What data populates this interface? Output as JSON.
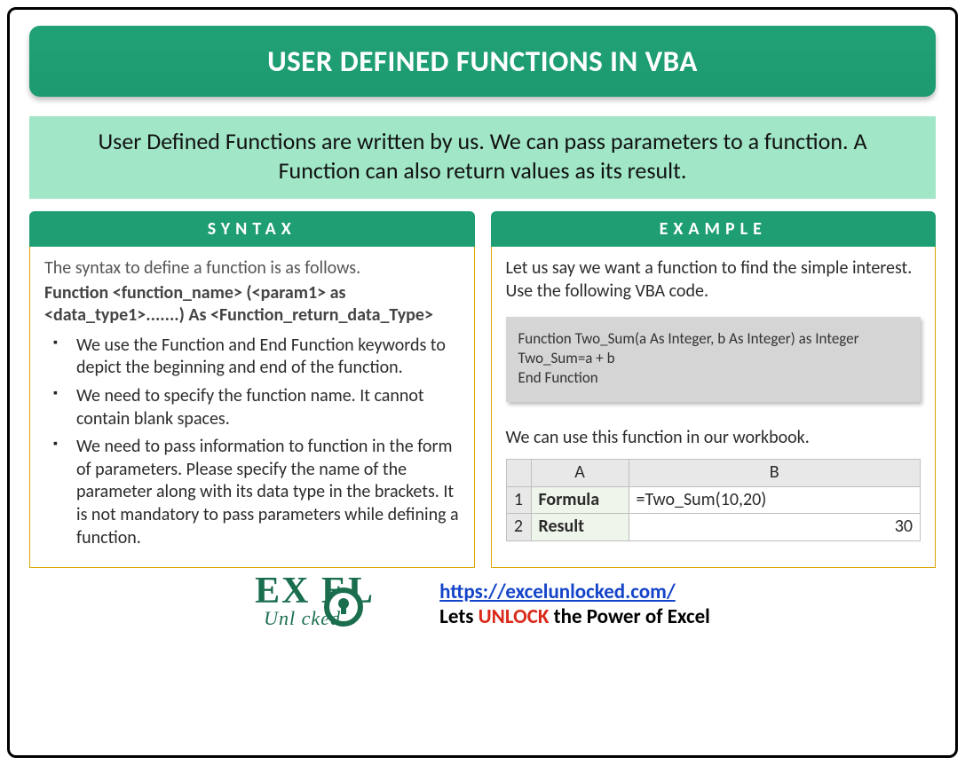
{
  "title": "USER DEFINED FUNCTIONS IN VBA",
  "intro": "User Defined Functions are written by us. We can pass parameters to a function. A Function can also return values as its result.",
  "syntax": {
    "header": "SYNTAX",
    "lead": "The syntax to define a function is as follows.",
    "signature": "Function <function_name> (<param1> as <data_type1>.......) As <Function_return_data_Type>",
    "bullets": [
      "We use the Function and End Function keywords to depict the beginning and end of the function.",
      "We need to specify the function name. It cannot contain blank spaces.",
      "We need to pass information to function in the form of parameters. Please specify the name of the parameter along with its data type in the brackets. It is not mandatory to pass parameters while defining a function."
    ]
  },
  "example": {
    "header": "EXAMPLE",
    "lead": "Let us say we want a function to find the simple interest. Use the following VBA code.",
    "code": "Function Two_Sum(a As Integer, b As Integer) as Integer\nTwo_Sum=a + b\nEnd Function",
    "use_text": "We can use this function in our workbook.",
    "table": {
      "col_a": "A",
      "col_b": "B",
      "row1_num": "1",
      "row2_num": "2",
      "row1_label": "Formula",
      "row1_value": "=Two_Sum(10,20)",
      "row2_label": "Result",
      "row2_value": "30"
    }
  },
  "footer": {
    "logo_top": "EX  EL",
    "logo_bottom": "Unl   cked",
    "url_text": "https://excelunlocked.com/",
    "tag_prefix": "Lets ",
    "tag_unlock": "UNLOCK",
    "tag_suffix": " the Power of Excel"
  }
}
